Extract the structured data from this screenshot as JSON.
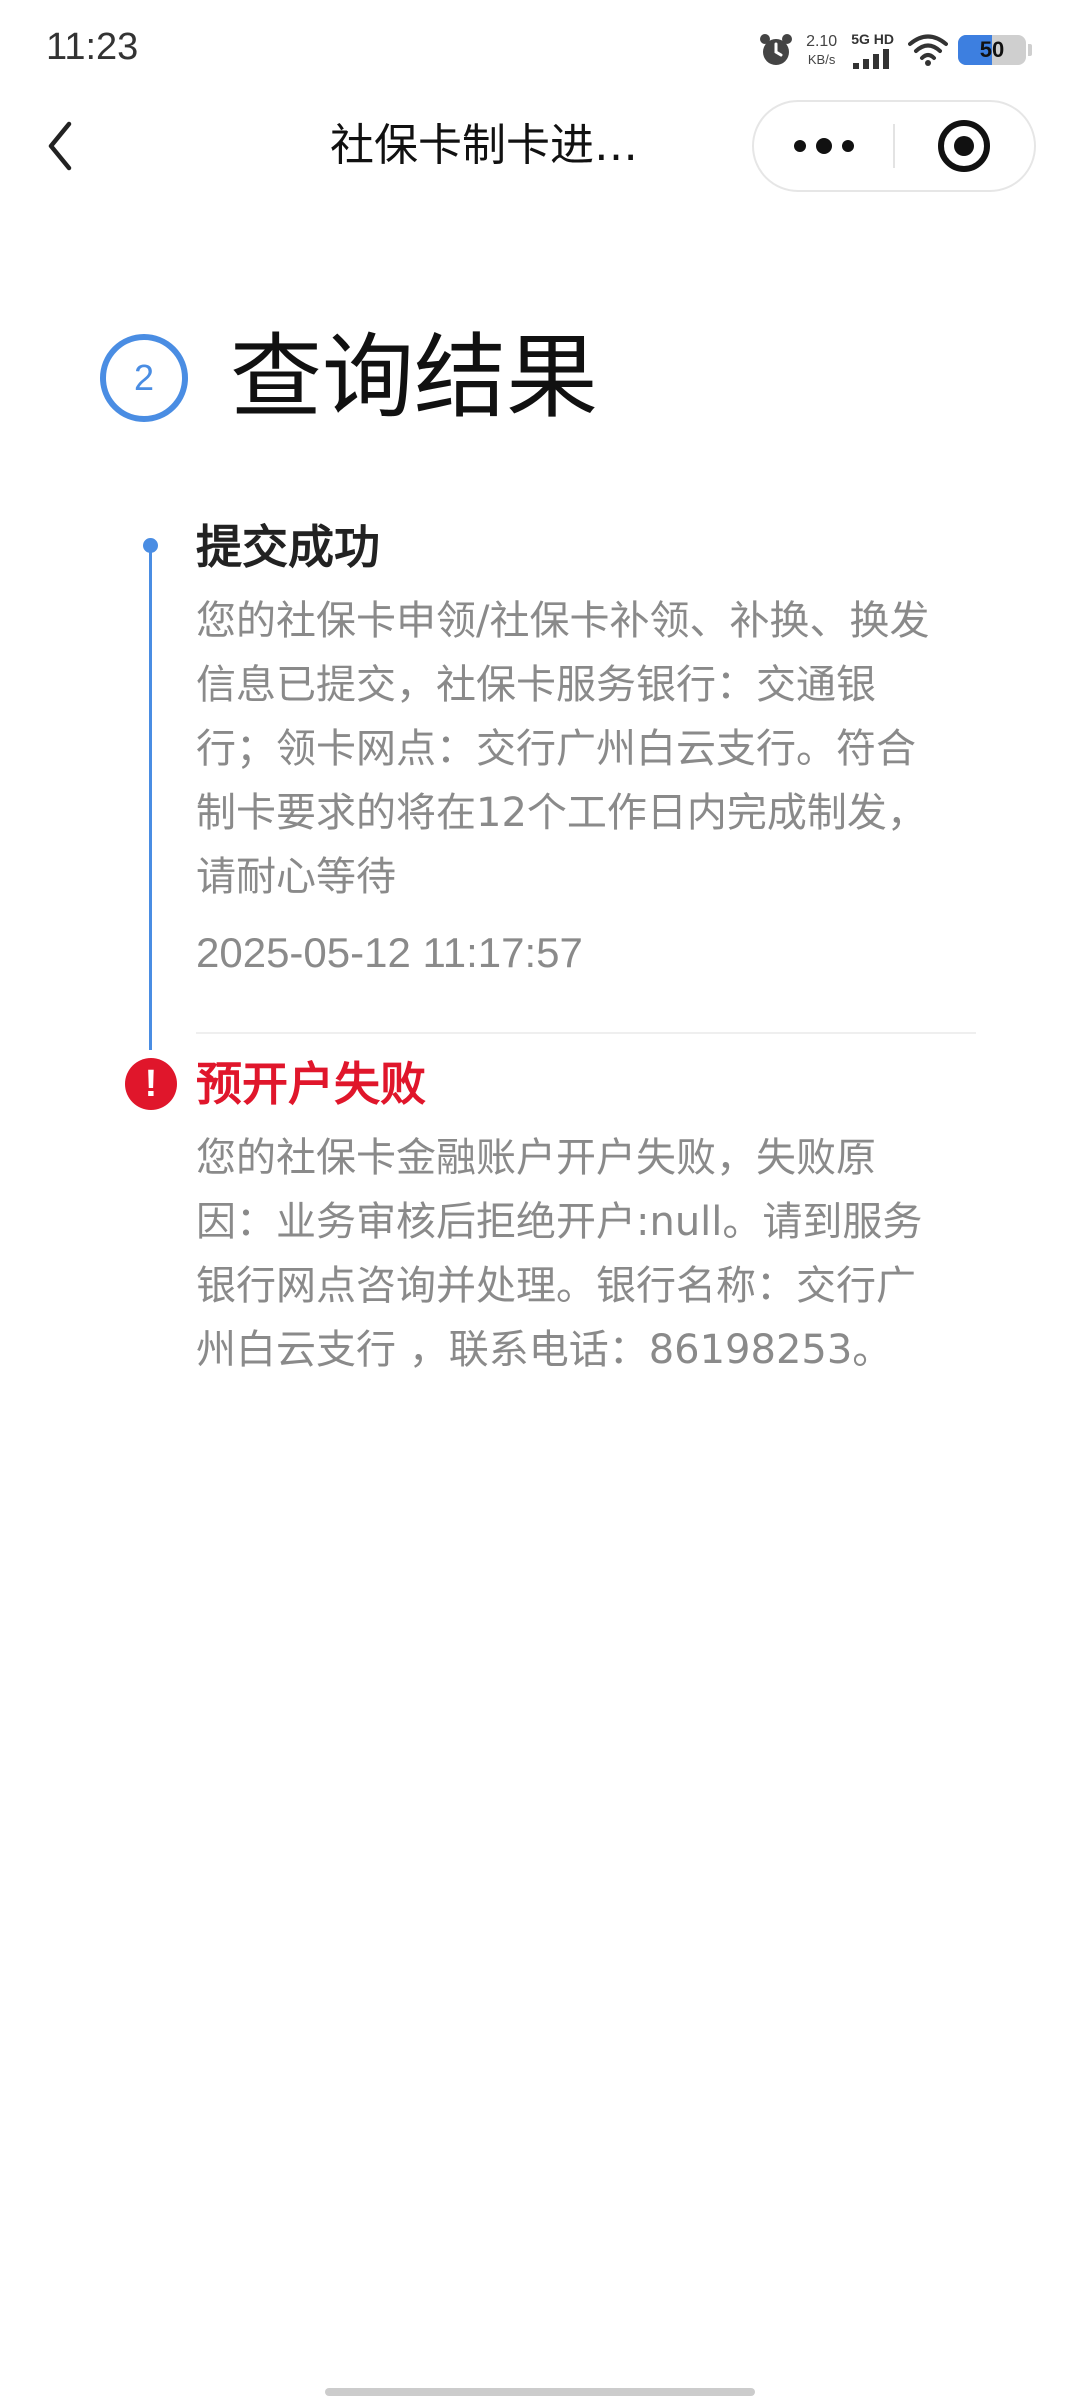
{
  "status_bar": {
    "time": "11:23",
    "net_speed_value": "2.10",
    "net_speed_unit": "KB/s",
    "network_label": "5G HD",
    "battery_level": "50",
    "battery_fraction": 0.5,
    "icons": [
      "alarm-icon",
      "signal-icon",
      "wifi-icon",
      "battery-icon"
    ]
  },
  "nav": {
    "back_icon": "chevron-left-icon",
    "title": "社保卡制卡进…",
    "more_icon": "more-dots-icon",
    "close_icon": "target-circle-icon"
  },
  "step": {
    "number": "2",
    "title": "查询结果"
  },
  "timeline": [
    {
      "status": "success",
      "title": "提交成功",
      "description": "您的社保卡申领/社保卡补领、补换、换发信息已提交，社保卡服务银行：交通银行；领卡网点：交行广州白云支行。符合制卡要求的将在12个工作日内完成制发，请耐心等待",
      "time": "2025-05-12 11:17:57"
    },
    {
      "status": "error",
      "icon": "exclamation-icon",
      "icon_glyph": "!",
      "title": "预开户失败",
      "description": "您的社保卡金融账户开户失败，失败原因：业务审核后拒绝开户:null。请到服务银行网点咨询并处理。银行名称：交行广州白云支行 ，联系电话：86198253。"
    }
  ],
  "colors": {
    "accent": "#4a8de3",
    "error": "#e0162b",
    "text_primary": "#222222",
    "text_secondary": "#8a8a8a"
  }
}
